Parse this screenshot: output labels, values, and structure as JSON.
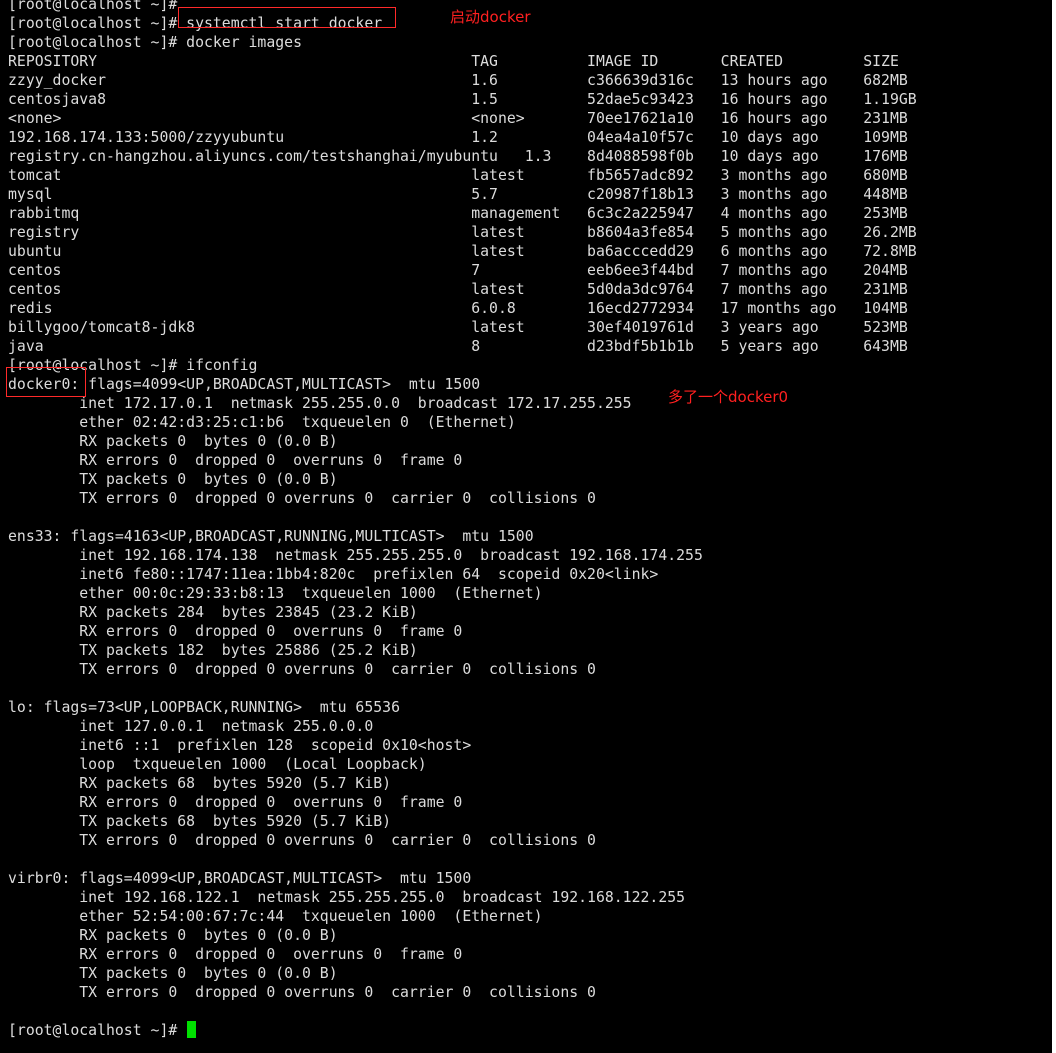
{
  "terminal": {
    "colors": {
      "background": "#000000",
      "text": "#dcdcdc",
      "cursor": "#00e000",
      "annotation": "#ff2020"
    },
    "lines": [
      "[root@localhost ~]# ",
      "[root@localhost ~]# systemctl start docker",
      "[root@localhost ~]# docker images",
      "REPOSITORY                                          TAG          IMAGE ID       CREATED         SIZE",
      "zzyy_docker                                         1.6          c366639d316c   13 hours ago    682MB",
      "centosjava8                                         1.5          52dae5c93423   16 hours ago    1.19GB",
      "<none>                                              <none>       70ee17621a10   16 hours ago    231MB",
      "192.168.174.133:5000/zzyyubuntu                     1.2          04ea4a10f57c   10 days ago     109MB",
      "registry.cn-hangzhou.aliyuncs.com/testshanghai/myubuntu   1.3    8d4088598f0b   10 days ago     176MB",
      "tomcat                                              latest       fb5657adc892   3 months ago    680MB",
      "mysql                                               5.7          c20987f18b13   3 months ago    448MB",
      "rabbitmq                                            management   6c3c2a225947   4 months ago    253MB",
      "registry                                            latest       b8604a3fe854   5 months ago    26.2MB",
      "ubuntu                                              latest       ba6acccedd29   6 months ago    72.8MB",
      "centos                                              7            eeb6ee3f44bd   7 months ago    204MB",
      "centos                                              latest       5d0da3dc9764   7 months ago    231MB",
      "redis                                               6.0.8        16ecd2772934   17 months ago   104MB",
      "billygoo/tomcat8-jdk8                               latest       30ef4019761d   3 years ago     523MB",
      "java                                                8            d23bdf5b1b1b   5 years ago     643MB",
      "[root@localhost ~]# ifconfig",
      "docker0: flags=4099<UP,BROADCAST,MULTICAST>  mtu 1500",
      "        inet 172.17.0.1  netmask 255.255.0.0  broadcast 172.17.255.255",
      "        ether 02:42:d3:25:c1:b6  txqueuelen 0  (Ethernet)",
      "        RX packets 0  bytes 0 (0.0 B)",
      "        RX errors 0  dropped 0  overruns 0  frame 0",
      "        TX packets 0  bytes 0 (0.0 B)",
      "        TX errors 0  dropped 0 overruns 0  carrier 0  collisions 0",
      "",
      "ens33: flags=4163<UP,BROADCAST,RUNNING,MULTICAST>  mtu 1500",
      "        inet 192.168.174.138  netmask 255.255.255.0  broadcast 192.168.174.255",
      "        inet6 fe80::1747:11ea:1bb4:820c  prefixlen 64  scopeid 0x20<link>",
      "        ether 00:0c:29:33:b8:13  txqueuelen 1000  (Ethernet)",
      "        RX packets 284  bytes 23845 (23.2 KiB)",
      "        RX errors 0  dropped 0  overruns 0  frame 0",
      "        TX packets 182  bytes 25886 (25.2 KiB)",
      "        TX errors 0  dropped 0 overruns 0  carrier 0  collisions 0",
      "",
      "lo: flags=73<UP,LOOPBACK,RUNNING>  mtu 65536",
      "        inet 127.0.0.1  netmask 255.0.0.0",
      "        inet6 ::1  prefixlen 128  scopeid 0x10<host>",
      "        loop  txqueuelen 1000  (Local Loopback)",
      "        RX packets 68  bytes 5920 (5.7 KiB)",
      "        RX errors 0  dropped 0  overruns 0  frame 0",
      "        TX packets 68  bytes 5920 (5.7 KiB)",
      "        TX errors 0  dropped 0 overruns 0  carrier 0  collisions 0",
      "",
      "virbr0: flags=4099<UP,BROADCAST,MULTICAST>  mtu 1500",
      "        inet 192.168.122.1  netmask 255.255.255.0  broadcast 192.168.122.255",
      "        ether 52:54:00:67:7c:44  txqueuelen 1000  (Ethernet)",
      "        RX packets 0  bytes 0 (0.0 B)",
      "        RX errors 0  dropped 0  overruns 0  frame 0",
      "        TX packets 0  bytes 0 (0.0 B)",
      "        TX errors 0  dropped 0 overruns 0  carrier 0  collisions 0",
      "",
      "[root@localhost ~]# "
    ]
  },
  "annotations": {
    "start_docker": "启动docker",
    "docker0_added": "多了一个docker0"
  }
}
